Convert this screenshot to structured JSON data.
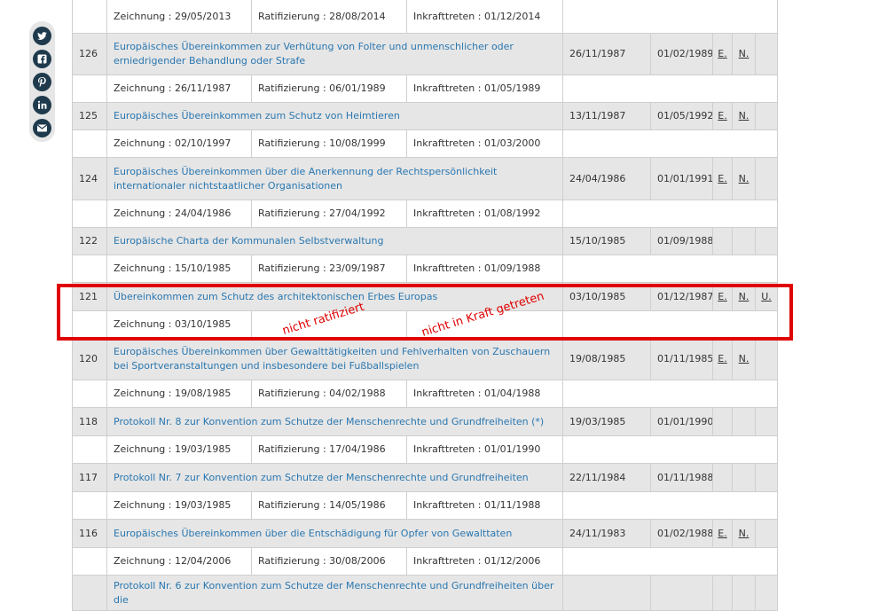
{
  "share": {
    "items": [
      {
        "name": "twitter-icon"
      },
      {
        "name": "facebook-icon"
      },
      {
        "name": "pinterest-icon"
      },
      {
        "name": "linkedin-icon"
      },
      {
        "name": "email-icon"
      }
    ]
  },
  "rows": [
    {
      "num": "",
      "title": "",
      "date1": "",
      "date2": "",
      "e": "",
      "n": "",
      "u": "",
      "z": "Zeichnung : 29/05/2013",
      "r": "Ratifizierung : 28/08/2014",
      "i": "Inkrafttreten : 01/12/2014"
    },
    {
      "num": "126",
      "title": "Europäisches Übereinkommen zur Verhütung von Folter und unmenschlicher oder erniedrigender Behandlung oder Strafe",
      "date1": "26/11/1987",
      "date2": "01/02/1989",
      "e": "E.",
      "n": "N.",
      "u": "",
      "z": "Zeichnung : 26/11/1987",
      "r": "Ratifizierung : 06/01/1989",
      "i": "Inkrafttreten : 01/05/1989"
    },
    {
      "num": "125",
      "title": "Europäisches Übereinkommen zum Schutz von Heimtieren",
      "date1": "13/11/1987",
      "date2": "01/05/1992",
      "e": "E.",
      "n": "N.",
      "u": "",
      "z": "Zeichnung : 02/10/1997",
      "r": "Ratifizierung : 10/08/1999",
      "i": "Inkrafttreten : 01/03/2000"
    },
    {
      "num": "124",
      "title": "Europäisches Übereinkommen über die Anerkennung der Rechtspersönlichkeit internationaler nichtstaatlicher Organisationen",
      "date1": "24/04/1986",
      "date2": "01/01/1991",
      "e": "E.",
      "n": "N.",
      "u": "",
      "z": "Zeichnung : 24/04/1986",
      "r": "Ratifizierung : 27/04/1992",
      "i": "Inkrafttreten : 01/08/1992"
    },
    {
      "num": "122",
      "title": "Europäische Charta der Kommunalen Selbstverwaltung",
      "date1": "15/10/1985",
      "date2": "01/09/1988",
      "e": "",
      "n": "",
      "u": "",
      "z": "Zeichnung : 15/10/1985",
      "r": "Ratifizierung : 23/09/1987",
      "i": "Inkrafttreten : 01/09/1988"
    },
    {
      "num": "121",
      "title": "Übereinkommen zum Schutz des architektonischen Erbes Europas",
      "date1": "03/10/1985",
      "date2": "01/12/1987",
      "e": "E.",
      "n": "N.",
      "u": "U.",
      "z": "Zeichnung : 03/10/1985",
      "r": "",
      "i": ""
    },
    {
      "num": "120",
      "title": "Europäisches Übereinkommen über Gewalttätigkeiten und Fehlverhalten von Zuschauern bei Sportveranstaltungen und insbesondere bei Fußballspielen",
      "date1": "19/08/1985",
      "date2": "01/11/1985",
      "e": "E.",
      "n": "N.",
      "u": "",
      "z": "Zeichnung : 19/08/1985",
      "r": "Ratifizierung : 04/02/1988",
      "i": "Inkrafttreten : 01/04/1988"
    },
    {
      "num": "118",
      "title": "Protokoll Nr. 8 zur Konvention zum Schutze der Menschenrechte und Grundfreiheiten (*)",
      "date1": "19/03/1985",
      "date2": "01/01/1990",
      "e": "",
      "n": "",
      "u": "",
      "z": "Zeichnung : 19/03/1985",
      "r": "Ratifizierung : 17/04/1986",
      "i": "Inkrafttreten : 01/01/1990"
    },
    {
      "num": "117",
      "title": "Protokoll Nr. 7 zur Konvention zum Schutze der Menschenrechte und Grundfreiheiten",
      "date1": "22/11/1984",
      "date2": "01/11/1988",
      "e": "",
      "n": "",
      "u": "",
      "z": "Zeichnung : 19/03/1985",
      "r": "Ratifizierung : 14/05/1986",
      "i": "Inkrafttreten : 01/11/1988"
    },
    {
      "num": "116",
      "title": "Europäisches Übereinkommen über die Entschädigung für Opfer von Gewalttaten",
      "date1": "24/11/1983",
      "date2": "01/02/1988",
      "e": "E.",
      "n": "N.",
      "u": "",
      "z": "Zeichnung : 12/04/2006",
      "r": "Ratifizierung : 30/08/2006",
      "i": "Inkrafttreten : 01/12/2006"
    },
    {
      "num": "",
      "title": "Protokoll Nr. 6 zur Konvention zum Schutze der Menschenrechte und Grundfreiheiten über die",
      "date1": "",
      "date2": "",
      "e": "",
      "n": "",
      "u": "",
      "z": "",
      "r": "",
      "i": ""
    }
  ],
  "annotations": {
    "note1": "nicht ratifiziert",
    "note2": "nicht in Kraft getreten"
  },
  "colors": {
    "highlight": "#e00000",
    "link": "#2a77b0",
    "row_bg": "#e6e6e6",
    "share_icon": "#1e3a4c"
  }
}
